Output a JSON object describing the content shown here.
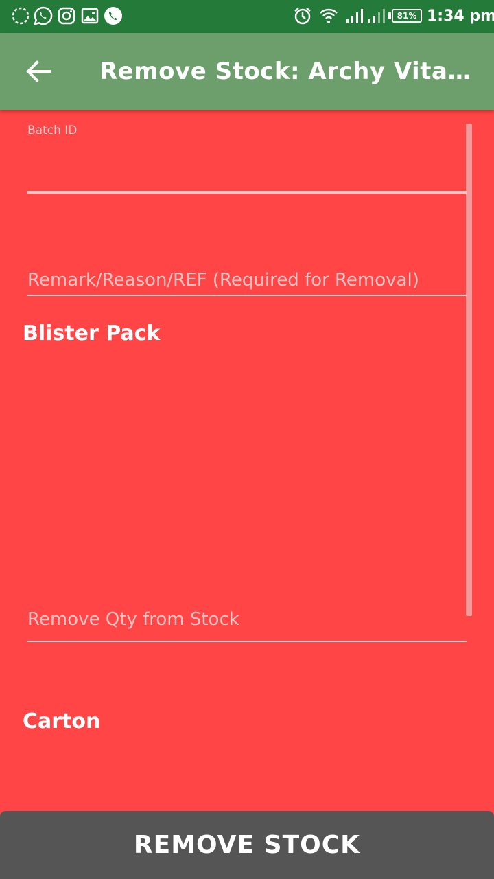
{
  "status_bar": {
    "left_icons": [
      "loading-ring-icon",
      "whatsapp-icon",
      "instagram-icon",
      "gallery-icon",
      "phone-call-icon"
    ],
    "right_icons": [
      "alarm-icon",
      "wifi-icon",
      "signal-sim1-icon",
      "signal-sim2-icon"
    ],
    "battery_percent": "81%",
    "time": "1:34 pm"
  },
  "app_bar": {
    "back_icon": "arrow-back-icon",
    "title": "Remove Stock: Archy Vitamin..."
  },
  "form": {
    "batch_id": {
      "label": "Batch ID",
      "value": ""
    },
    "remark": {
      "placeholder": "Remark/Reason/REF (Required for Removal)",
      "value": ""
    },
    "blister_pack": {
      "heading": "Blister Pack",
      "qty_placeholder": "Remove Qty from Stock",
      "qty_value": ""
    },
    "carton": {
      "heading": "Carton"
    }
  },
  "actions": {
    "remove_stock_label": "REMOVE STOCK"
  },
  "colors": {
    "status_bar": "#237a39",
    "app_bar": "#6c9f6c",
    "background": "#ff4545",
    "button": "#555555"
  }
}
